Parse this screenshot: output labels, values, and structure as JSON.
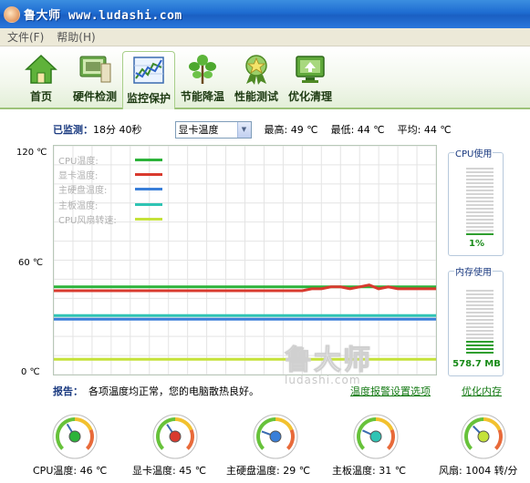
{
  "window": {
    "title": "鲁大师 www.ludashi.com"
  },
  "menu": [
    {
      "label": "文件(F)"
    },
    {
      "label": "帮助(H)"
    }
  ],
  "toolbar": [
    {
      "label": "首页",
      "icon": "home-icon",
      "active": false
    },
    {
      "label": "硬件检测",
      "icon": "hardware-icon",
      "active": false
    },
    {
      "label": "监控保护",
      "icon": "monitor-chart-icon",
      "active": true
    },
    {
      "label": "节能降温",
      "icon": "leaf-icon",
      "active": false
    },
    {
      "label": "性能测试",
      "icon": "star-medal-icon",
      "active": false
    },
    {
      "label": "优化清理",
      "icon": "clean-monitor-icon",
      "active": false
    }
  ],
  "monitor": {
    "elapsed_label": "已监测：",
    "elapsed_value": "18分 40秒",
    "sensor_select": "显卡温度",
    "max_label": "最高:",
    "max_value": "49 ℃",
    "min_label": "最低:",
    "min_value": "44 ℃",
    "avg_label": "平均:",
    "avg_value": "44 ℃"
  },
  "chart_data": {
    "type": "line",
    "yticks": [
      "120 ℃",
      "60 ℃",
      "0 ℃"
    ],
    "ylim": [
      0,
      120
    ],
    "grid": true,
    "legend": "top-left",
    "series": [
      {
        "name": "CPU温度:",
        "color": "#2cb33a",
        "values": [
          46,
          46,
          46,
          46,
          46,
          46,
          46,
          46,
          46,
          46,
          46,
          46,
          46,
          46,
          46,
          46,
          46,
          46,
          46,
          46,
          46,
          46,
          46,
          46,
          46,
          46,
          46,
          46,
          46,
          46,
          46,
          46,
          46,
          46,
          46,
          46,
          46,
          46,
          46,
          46,
          46
        ]
      },
      {
        "name": "显卡温度:",
        "color": "#d93a2e",
        "values": [
          44,
          44,
          44,
          44,
          44,
          44,
          44,
          44,
          44,
          44,
          44,
          44,
          44,
          44,
          44,
          44,
          44,
          44,
          44,
          44,
          44,
          44,
          44,
          44,
          44,
          44,
          44,
          45,
          45,
          46,
          46,
          45,
          46,
          47,
          45,
          46,
          45,
          45,
          45,
          45,
          45
        ]
      },
      {
        "name": "主硬盘温度:",
        "color": "#3a7fd9",
        "values": [
          29,
          29,
          29,
          29,
          29,
          29,
          29,
          29,
          29,
          29,
          29,
          29,
          29,
          29,
          29,
          29,
          29,
          29,
          29,
          29,
          29,
          29,
          29,
          29,
          29,
          29,
          29,
          29,
          29,
          29,
          29,
          29,
          29,
          29,
          29,
          29,
          29,
          29,
          29,
          29,
          29
        ]
      },
      {
        "name": "主板温度:",
        "color": "#2fc4b4",
        "values": [
          31,
          31,
          31,
          31,
          31,
          31,
          31,
          31,
          31,
          31,
          31,
          31,
          31,
          31,
          31,
          31,
          31,
          31,
          31,
          31,
          31,
          31,
          31,
          31,
          31,
          31,
          31,
          31,
          31,
          31,
          31,
          31,
          31,
          31,
          31,
          31,
          31,
          31,
          31,
          31,
          31
        ]
      },
      {
        "name": "CPU风扇转速:",
        "color": "#c5e23a",
        "values": [
          8,
          8,
          8,
          8,
          8,
          8,
          8,
          8,
          8,
          8,
          8,
          8,
          8,
          8,
          8,
          8,
          8,
          8,
          8,
          8,
          8,
          8,
          8,
          8,
          8,
          8,
          8,
          8,
          8,
          8,
          8,
          8,
          8,
          8,
          8,
          8,
          8,
          8,
          8,
          8,
          8
        ]
      }
    ]
  },
  "watermark": {
    "big": "鲁大师",
    "small": "ludashi.com"
  },
  "cpu_meter": {
    "title": "CPU使用",
    "value": "1%",
    "fraction": 0.01
  },
  "mem_meter": {
    "title": "内存使用",
    "value": "578.7 MB",
    "fraction": 0.22
  },
  "report": {
    "label": "报告：",
    "text": "各项温度均正常，您的电脑散热良好。",
    "link_alarm": "温度报警设置选项",
    "link_optimize": "优化内存"
  },
  "gauges": [
    {
      "label": "CPU温度: 46 ℃",
      "value": 46,
      "max": 120,
      "color": "#2cb33a"
    },
    {
      "label": "显卡温度: 45 ℃",
      "value": 45,
      "max": 120,
      "color": "#d93a2e"
    },
    {
      "label": "主硬盘温度: 29 ℃",
      "value": 29,
      "max": 120,
      "color": "#3a7fd9"
    },
    {
      "label": "主板温度: 31 ℃",
      "value": 31,
      "max": 120,
      "color": "#2fc4b4"
    },
    {
      "label": "风扇: 1004 转/分",
      "value": 1004,
      "max": 3000,
      "color": "#c5e23a"
    }
  ]
}
